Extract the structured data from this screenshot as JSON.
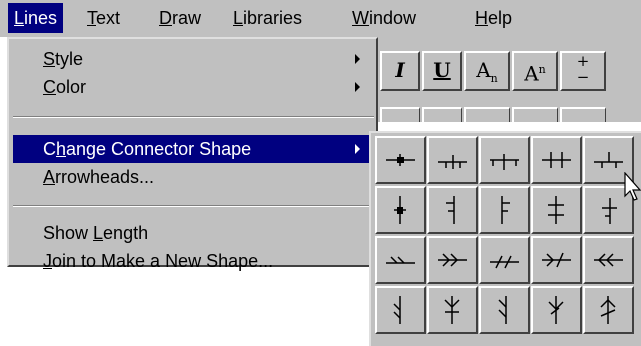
{
  "menubar": {
    "items": [
      {
        "label": "Lines",
        "selected": true
      },
      {
        "label": "Text"
      },
      {
        "label": "Draw"
      },
      {
        "label": "Libraries"
      },
      {
        "label": "Window"
      },
      {
        "label": "Help"
      }
    ]
  },
  "toolbar": {
    "buttons": [
      "I",
      "U",
      "An",
      "An",
      "+/-"
    ]
  },
  "lines_menu": {
    "items": [
      {
        "label": "Style",
        "submenu": true
      },
      {
        "label": "Color",
        "submenu": true
      },
      {
        "label": "Change Connector Shape",
        "submenu": true,
        "highlighted": true
      },
      {
        "label": "Arrowheads..."
      },
      {
        "label": "Show Length"
      },
      {
        "label": "Join to Make a New Shape..."
      }
    ]
  },
  "connector_palette": {
    "rows": 4,
    "columns": 5,
    "shapes": [
      "connector-square-tick-icon",
      "connector-single-tick-icon",
      "connector-tee-icon",
      "connector-double-tick-icon",
      "connector-offset-tick-icon",
      "connector-vertical-dot-icon",
      "connector-vertical-left-tick-icon",
      "connector-vertical-right-tick-icon",
      "connector-vertical-double-tick-icon",
      "connector-vertical-corner-icon",
      "connector-double-slash-icon",
      "connector-double-arrow-right-icon",
      "connector-slash-arrow-icon",
      "connector-arrow-slash-icon",
      "connector-double-arrow-left-icon",
      "connector-vertical-crow-icon",
      "connector-vertical-fork-icon",
      "connector-vertical-hook-icon",
      "connector-vertical-branch-icon",
      "connector-vertical-arrow-up-icon"
    ]
  },
  "colors": {
    "menu_bg": "#c0c0c0",
    "highlight": "#000080",
    "highlight_text": "#ffffff"
  }
}
